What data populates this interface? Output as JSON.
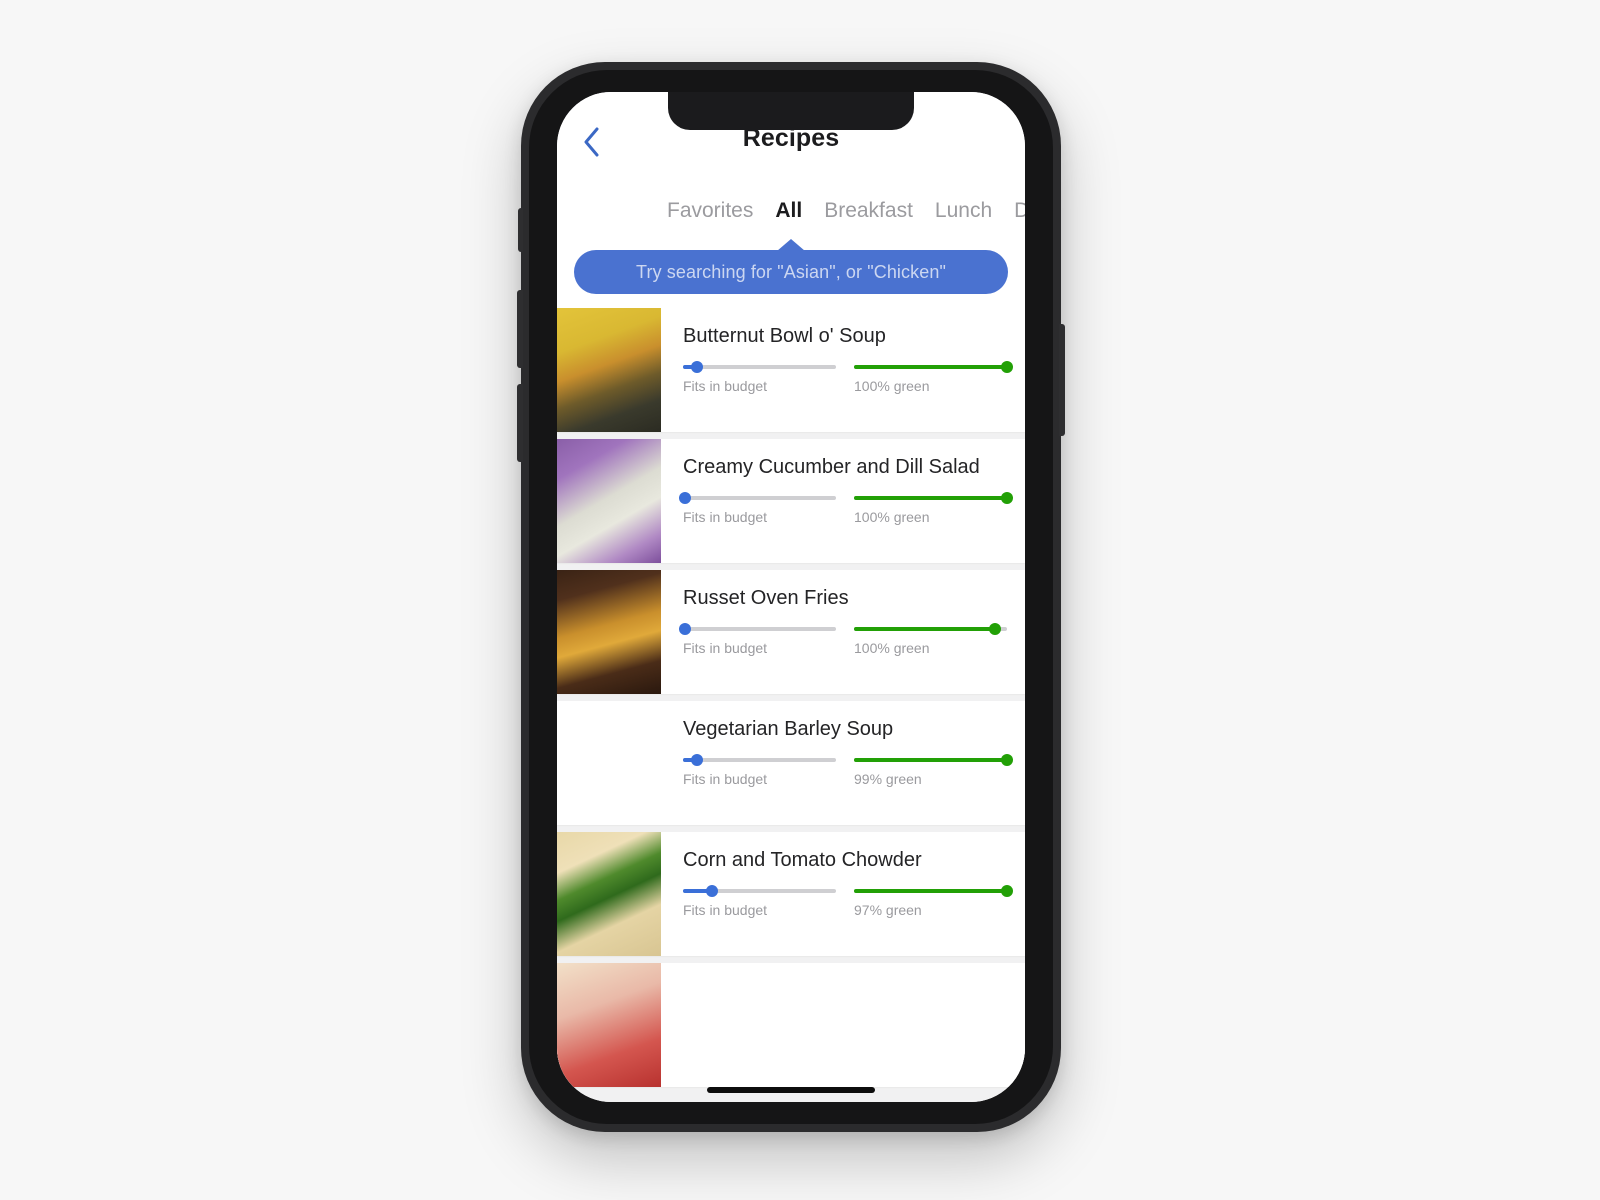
{
  "header": {
    "title": "Recipes",
    "back_icon": "chevron-left-icon"
  },
  "tabs": [
    {
      "label": "Favorites",
      "active": false
    },
    {
      "label": "All",
      "active": true
    },
    {
      "label": "Breakfast",
      "active": false
    },
    {
      "label": "Lunch",
      "active": false
    },
    {
      "label": "Di",
      "active": false
    }
  ],
  "tooltip": {
    "text": "Try searching for \"Asian\", or \"Chicken\"",
    "bg_color": "#4a72d0",
    "text_color": "#ccd7f1"
  },
  "colors": {
    "budget_blue": "#3a6fd8",
    "green": "#22a006",
    "track_gray": "#cfcfd2",
    "list_bg": "#f1f1f2",
    "accent_blue": "#3b68c4"
  },
  "recipes": [
    {
      "title": "Butternut Bowl o' Soup",
      "budget_label": "Fits in budget",
      "budget_percent": 9,
      "green_label": "100% green",
      "green_percent": 100,
      "thumb_name": "butternut-soup-thumbnail",
      "thumb_css": "linear-gradient(160deg,#e3c43a 0%,#d9b832 28%,#c98f2d 46%,#6e5b2a 63%,#3a3a2c 80%,#2b2b22 100%)"
    },
    {
      "title": "Creamy Cucumber and Dill Salad",
      "budget_label": "Fits in budget",
      "budget_percent": 1,
      "green_label": "100% green",
      "green_percent": 100,
      "thumb_name": "cucumber-salad-thumbnail",
      "thumb_css": "linear-gradient(150deg,#8a5fa8 0%,#a074bd 22%,#dcdcd2 48%,#e8e8de 64%,#b089c4 84%,#7d4f9c 100%)"
    },
    {
      "title": "Russet Oven Fries",
      "budget_label": "Fits in budget",
      "budget_percent": 1,
      "green_label": "100% green",
      "green_percent": 92,
      "thumb_name": "oven-fries-thumbnail",
      "thumb_css": "linear-gradient(165deg,#3a2315 0%,#50301c 20%,#c98f2c 45%,#e0a93a 58%,#4a2c18 78%,#2a180e 100%)"
    },
    {
      "title": "Vegetarian Barley Soup",
      "budget_label": "Fits in budget",
      "budget_percent": 9,
      "green_label": "99% green",
      "green_percent": 100,
      "thumb_name": "barley-soup-thumbnail",
      "thumb_css": "linear-gradient(155deg,#c96a3a 0%,#d9catch 1%,#e8d9b4 30%,#d8c49a 55%,#c4a97e 75%,#b4652f 100%)"
    },
    {
      "title": "Corn and Tomato Chowder",
      "budget_label": "Fits in budget",
      "budget_percent": 19,
      "green_label": "97% green",
      "green_percent": 100,
      "thumb_name": "corn-chowder-thumbnail",
      "thumb_css": "linear-gradient(155deg,#e8d8a8 0%,#efe0b8 24%,#4f8a2c 40%,#2f6a1c 52%,#e5d4a4 70%,#d8c592 100%)"
    },
    {
      "title": "",
      "budget_label": "",
      "budget_percent": 0,
      "green_label": "",
      "green_percent": 0,
      "thumb_name": "partial-recipe-thumbnail",
      "thumb_css": "linear-gradient(160deg,#f2e0c8 0%,#e9b9a8 35%,#d4564f 70%,#b8322f 100%)"
    }
  ]
}
